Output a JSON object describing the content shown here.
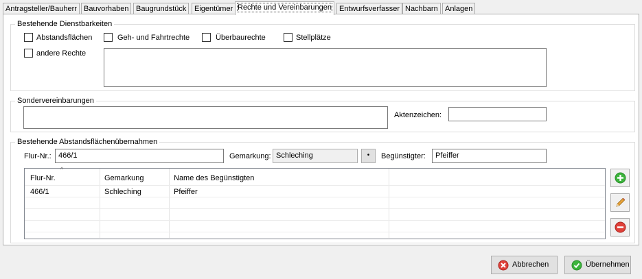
{
  "tabs": [
    {
      "label": "Antragsteller/Bauherr"
    },
    {
      "label": "Bauvorhaben"
    },
    {
      "label": "Baugrundstück"
    },
    {
      "label": "Eigentümer"
    },
    {
      "label": "Rechte und Vereinbarungen"
    },
    {
      "label": "Entwurfsverfasser"
    },
    {
      "label": "Nachbarn"
    },
    {
      "label": "Anlagen"
    }
  ],
  "dienst": {
    "title": "Bestehende Dienstbarkeiten",
    "abstandsflaechen": "Abstandsflächen",
    "geh_fahrtrechte": "Geh- und Fahrtrechte",
    "ueberbaurechte": "Überbaurechte",
    "stellplaetze": "Stellplätze",
    "andere_rechte": "andere Rechte",
    "andere_rechte_text": ""
  },
  "sonder": {
    "title": "Sondervereinbarungen",
    "text": "",
    "aktenzeichen_label": "Aktenzeichen:",
    "aktenzeichen_value": ""
  },
  "abstand": {
    "title": "Bestehende Abstandsflächenübernahmen",
    "flur_label": "Flur-Nr.:",
    "flur_value": "466/1",
    "gemarkung_label": "Gemarkung:",
    "gemarkung_value": "Schleching",
    "beguenstigter_label": "Begünstigter:",
    "beguenstigter_value": "Pfeiffer",
    "columns": [
      "Flur-Nr.",
      "Gemarkung",
      "Name des Begünstigten"
    ],
    "rows": [
      [
        "466/1",
        "Schleching",
        "Pfeiffer"
      ]
    ]
  },
  "buttons": {
    "abbrechen": "Abbrechen",
    "uebernehmen": "Übernehmen"
  },
  "icons": {
    "add": "plus-circle-icon",
    "edit": "pencil-icon",
    "remove": "minus-circle-icon",
    "cancel": "cancel-icon",
    "ok": "check-icon"
  },
  "colors": {
    "add_green": "#3cb43c",
    "remove_red": "#e0413a",
    "pencil_orange": "#e8a33a"
  }
}
